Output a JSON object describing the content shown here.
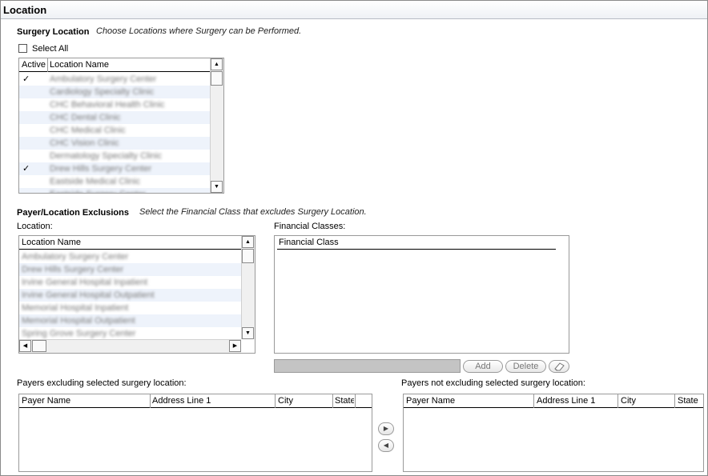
{
  "window": {
    "title": "Location"
  },
  "surgery_location": {
    "heading": "Surgery Location",
    "hint": "Choose Locations where Surgery can be Performed.",
    "select_all_label": "Select All",
    "columns": [
      "Active",
      "Location Name"
    ],
    "rows": [
      {
        "active": "✓",
        "name": "Ambulatory Surgery Center"
      },
      {
        "active": "",
        "name": "Cardiology Specialty Clinic"
      },
      {
        "active": "",
        "name": "CHC Behavioral Health Clinic"
      },
      {
        "active": "",
        "name": "CHC Dental Clinic"
      },
      {
        "active": "",
        "name": "CHC Medical Clinic"
      },
      {
        "active": "",
        "name": "CHC Vision Clinic"
      },
      {
        "active": "",
        "name": "Dermatology Specialty Clinic"
      },
      {
        "active": "✓",
        "name": "Drew Hills Surgery Center"
      },
      {
        "active": "",
        "name": "Eastside Medical Clinic"
      },
      {
        "active": "",
        "name": "Eastside Surgery Center"
      }
    ]
  },
  "exclusions": {
    "heading": "Payer/Location Exclusions",
    "hint": "Select the Financial Class that excludes Surgery Location.",
    "location_label": "Location:",
    "location_column": "Location Name",
    "locations": [
      "Ambulatory Surgery Center",
      "Drew Hills Surgery Center",
      "Irvine General Hospital Inpatient",
      "Irvine General Hospital Outpatient",
      "Memorial Hospital Inpatient",
      "Memorial Hospital Outpatient",
      "Spring Grove Surgery Center"
    ],
    "financial_label": "Financial Classes:",
    "financial_column": "Financial Class",
    "add_label": "Add",
    "delete_label": "Delete"
  },
  "payers_excluding": {
    "label": "Payers excluding selected surgery location:",
    "columns": [
      "Payer Name",
      "Address Line 1",
      "City",
      "State"
    ]
  },
  "payers_not_excluding": {
    "label": "Payers not excluding selected surgery location:",
    "columns": [
      "Payer Name",
      "Address Line 1",
      "City",
      "State"
    ]
  },
  "icons": {
    "move_right": "right-arrow-icon",
    "move_left": "left-arrow-icon",
    "eraser": "eraser-icon"
  }
}
